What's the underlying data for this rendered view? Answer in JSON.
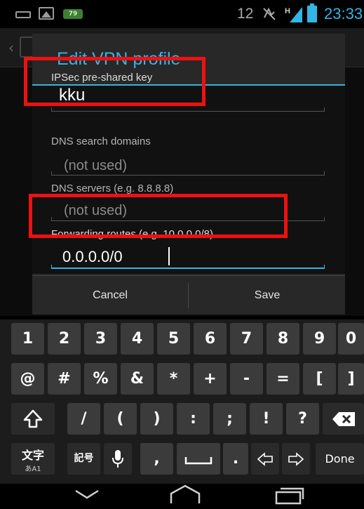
{
  "status_bar": {
    "battery_small": "79",
    "notification_count": "12",
    "clock": "23:33",
    "signal_label": "H"
  },
  "dialog": {
    "title": "Edit VPN profile",
    "fields": [
      {
        "label": "IPSec pre-shared key",
        "value": "kku"
      },
      {
        "label": "DNS search domains",
        "placeholder": "(not used)"
      },
      {
        "label": "DNS servers (e.g. 8.8.8.8)",
        "placeholder": "(not used)"
      },
      {
        "label": "Forwarding routes (e.g. 10.0.0.0/8)",
        "value": "0.0.0.0/0"
      }
    ],
    "cancel_label": "Cancel",
    "save_label": "Save"
  },
  "keyboard": {
    "rows": [
      [
        "1",
        "2",
        "3",
        "4",
        "5",
        "6",
        "7",
        "8",
        "9",
        "0"
      ],
      [
        "@",
        "#",
        "%",
        "&",
        "*",
        "+",
        "-",
        "=",
        "[",
        "]"
      ],
      [
        "shift",
        "/",
        "(",
        ")",
        ":",
        ";",
        "!",
        "?",
        "backspace"
      ],
      [
        "文字 あA1",
        "記号",
        "mic",
        ",",
        "space",
        ".",
        "left",
        "right",
        "Done"
      ]
    ],
    "done_label": "Done",
    "lang_label": "文字",
    "lang_sub": "あA1",
    "symbols_label": "記号"
  },
  "colors": {
    "accent": "#33b5e5",
    "highlight": "#ee1111",
    "dialog_bg": "#282828"
  }
}
